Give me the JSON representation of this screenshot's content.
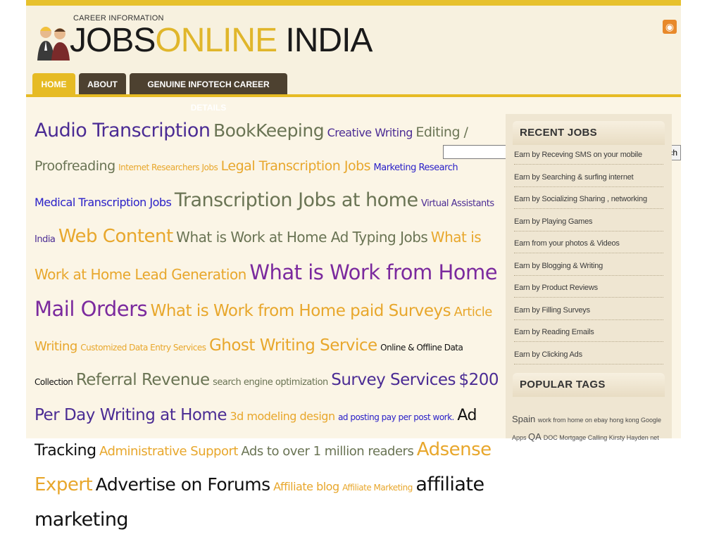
{
  "header": {
    "tagline": "CAREER INFORMATION",
    "logo_part1": "JOBS",
    "logo_part2": "ONLINE",
    "logo_part3": " INDIA"
  },
  "nav": {
    "tabs": [
      {
        "label": "HOME"
      },
      {
        "label": "ABOUT"
      },
      {
        "label": "GENUINE INFOTECH CAREER DETAILS"
      }
    ]
  },
  "search": {
    "value": "",
    "button_label": "Search"
  },
  "tag_cloud": [
    {
      "text": "Audio Transcription",
      "color": "#4b2c94"
    },
    {
      "text": "BookKeeping",
      "color": "#6a7454"
    },
    {
      "text": "Creative Writing",
      "color": "#4b2c94"
    },
    {
      "text": "Editing / Proofreading",
      "color": "#6a7454"
    },
    {
      "text": "Internet Researchers Jobs",
      "color": "#e8a72c"
    },
    {
      "text": "Legal Transcription Jobs",
      "color": "#e8a72c"
    },
    {
      "text": "Marketing Research",
      "color": "#2a20c8"
    },
    {
      "text": "Medical Transcription Jobs",
      "color": "#2a20c8"
    },
    {
      "text": "Transcription Jobs at home",
      "color": "#6a7454"
    },
    {
      "text": "Virtual Assistants India",
      "color": "#4b2c94"
    },
    {
      "text": "Web Content",
      "color": "#e8a72c"
    },
    {
      "text": "What is Work at Home Ad Typing Jobs",
      "color": "#6a7454"
    },
    {
      "text": "What is Work at Home Lead Generation",
      "color": "#e8a72c"
    },
    {
      "text": "What is Work from Home Mail Orders",
      "color": "#7b2a9e"
    },
    {
      "text": "What is Work from Home paid Surveys",
      "color": "#e8a72c"
    },
    {
      "text": "Article Writing",
      "color": "#e8a72c"
    },
    {
      "text": "Customized Data Entry Services",
      "color": "#e8a72c"
    },
    {
      "text": "Ghost Writing Service",
      "color": "#e8a72c"
    },
    {
      "text": "Online & Offline Data Collection",
      "color": "#111111"
    },
    {
      "text": "Referral Revenue",
      "color": "#6a7454"
    },
    {
      "text": "search engine optimization",
      "color": "#6a7454"
    },
    {
      "text": "Survey Services",
      "color": "#4b2c94"
    },
    {
      "text": "$200 Per Day Writing at Home",
      "color": "#4b2c94"
    },
    {
      "text": "3d modeling design",
      "color": "#e8a72c"
    },
    {
      "text": "ad posting pay per post work.",
      "color": "#2a20c8"
    },
    {
      "text": "Ad Tracking",
      "color": "#111111"
    },
    {
      "text": "Administrative Support",
      "color": "#e8a72c"
    },
    {
      "text": "Ads to over 1 million readers",
      "color": "#6a7454"
    },
    {
      "text": "Adsense Expert",
      "color": "#e8a72c"
    },
    {
      "text": "Advertise on Forums",
      "color": "#111111"
    },
    {
      "text": "Affiliate blog",
      "color": "#e8a72c"
    },
    {
      "text": "Affiliate Marketing",
      "color": "#e8a72c"
    },
    {
      "text": "affiliate marketing",
      "color": "#111111"
    }
  ],
  "sidebar": {
    "recent_title": "RECENT JOBS",
    "recent_items": [
      "Earn by Receving SMS on your mobile",
      "Earn by Searching & surfing internet",
      "Earn by Socializing Sharing , networking",
      "Earn by Playing Games",
      "Earn from your photos & Videos",
      "Earn by Blogging & Writing",
      "Earn by Product Reviews",
      "Earn by Filling Surveys",
      "Earn by Reading Emails",
      "Earn by Clicking Ads"
    ],
    "popular_title": "POPULAR TAGS",
    "popular_tags": [
      "Spain",
      "work from home on ebay",
      "hong kong",
      "Google",
      "Apps",
      "QA",
      "DOC",
      "Mortgage",
      "Calling",
      "Kirsty",
      "Hayden",
      "net"
    ]
  },
  "icons": {
    "rss": "rss-icon",
    "logo": "people-logo-icon"
  },
  "colors": {
    "accent": "#e6bb24",
    "nav_dark": "#4d4130",
    "page_bg": "#fbf5e6",
    "sidebar_bg": "#efe6d2"
  }
}
